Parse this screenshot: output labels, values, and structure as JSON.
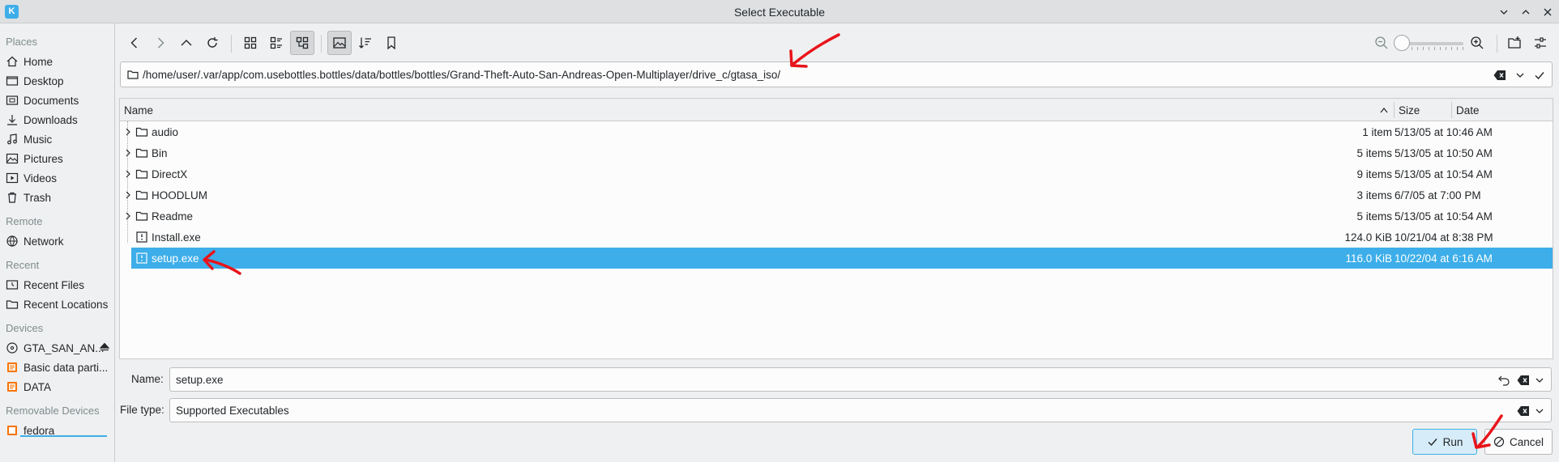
{
  "window": {
    "title": "Select Executable",
    "logo": "K"
  },
  "sidebar": {
    "sections": [
      {
        "heading": "Places",
        "items": [
          {
            "label": "Home",
            "icon": "home-icon"
          },
          {
            "label": "Desktop",
            "icon": "desktop-icon"
          },
          {
            "label": "Documents",
            "icon": "documents-icon"
          },
          {
            "label": "Downloads",
            "icon": "downloads-icon"
          },
          {
            "label": "Music",
            "icon": "music-icon"
          },
          {
            "label": "Pictures",
            "icon": "pictures-icon"
          },
          {
            "label": "Videos",
            "icon": "videos-icon"
          },
          {
            "label": "Trash",
            "icon": "trash-icon"
          }
        ]
      },
      {
        "heading": "Remote",
        "items": [
          {
            "label": "Network",
            "icon": "network-icon"
          }
        ]
      },
      {
        "heading": "Recent",
        "items": [
          {
            "label": "Recent Files",
            "icon": "recent-files-icon"
          },
          {
            "label": "Recent Locations",
            "icon": "recent-locations-icon"
          }
        ]
      },
      {
        "heading": "Devices",
        "items": [
          {
            "label": "GTA_SAN_AN...",
            "icon": "optical-disc-icon"
          },
          {
            "label": "Basic data parti...",
            "icon": "drive-icon"
          },
          {
            "label": "DATA",
            "icon": "drive-icon"
          }
        ]
      },
      {
        "heading": "Removable Devices",
        "items": [
          {
            "label": "fedora",
            "icon": "removable-drive-icon"
          }
        ]
      }
    ]
  },
  "location": {
    "path": "/home/user/.var/app/com.usebottles.bottles/data/bottles/bottles/Grand-Theft-Auto-San-Andreas-Open-Multiplayer/drive_c/gtasa_iso/"
  },
  "columns": {
    "name": "Name",
    "size": "Size",
    "date": "Date"
  },
  "files": [
    {
      "name": "audio",
      "type": "folder",
      "size": "1 item",
      "date": "5/13/05 at 10:46 AM"
    },
    {
      "name": "Bin",
      "type": "folder",
      "size": "5 items",
      "date": "5/13/05 at 10:50 AM"
    },
    {
      "name": "DirectX",
      "type": "folder",
      "size": "9 items",
      "date": "5/13/05 at 10:54 AM"
    },
    {
      "name": "HOODLUM",
      "type": "folder",
      "size": "3 items",
      "date": "6/7/05 at 7:00 PM"
    },
    {
      "name": "Readme",
      "type": "folder",
      "size": "5 items",
      "date": "5/13/05 at 10:54 AM"
    },
    {
      "name": "Install.exe",
      "type": "executable",
      "size": "124.0 KiB",
      "date": "10/21/04 at 8:38 PM"
    },
    {
      "name": "setup.exe",
      "type": "executable",
      "size": "116.0 KiB",
      "date": "10/22/04 at 6:16 AM",
      "selected": true
    }
  ],
  "form": {
    "name_label": "Name:",
    "name_value": "setup.exe",
    "filetype_label": "File type:",
    "filetype_value": "Supported Executables",
    "run_label": "Run",
    "cancel_label": "Cancel"
  },
  "colors": {
    "accent": "#3daee9",
    "annotation": "#e8141b",
    "window_bg": "#eff0f1"
  }
}
